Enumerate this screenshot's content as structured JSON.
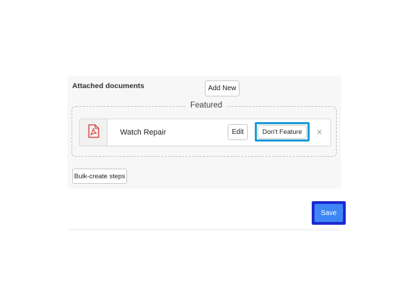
{
  "attachments": {
    "heading": "Attached documents",
    "add_new_label": "Add New",
    "featured_label": "Featured",
    "document": {
      "title": "Watch Repair",
      "file_icon": "pdf-file-icon",
      "edit_label": "Edit",
      "unfeature_label": "Don't Feature",
      "remove_glyph": "×"
    },
    "bulk_create_label": "Bulk-create steps"
  },
  "footer": {
    "save_label": "Save"
  },
  "colors": {
    "highlight": "#1a9ad6",
    "save_highlight": "#1d2ad0",
    "save_button": "#3e86f5",
    "pdf_icon": "#d9322f"
  }
}
